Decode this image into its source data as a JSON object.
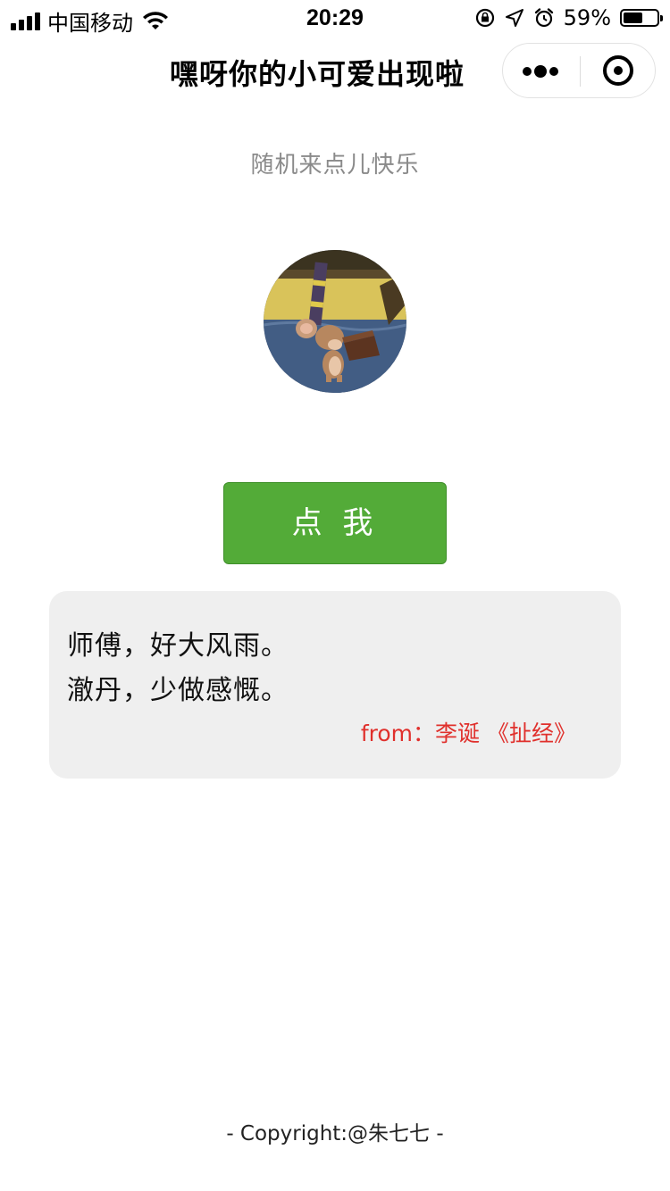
{
  "status_bar": {
    "carrier": "中国移动",
    "time": "20:29",
    "battery_percent": "59%",
    "battery_level": 0.59,
    "icons": [
      "signal-icon",
      "wifi-icon",
      "orientation-lock-icon",
      "location-icon",
      "alarm-icon",
      "battery-icon"
    ]
  },
  "nav": {
    "title": "嘿呀你的小可爱出现啦",
    "capsule_icons": [
      "more-icon",
      "close-miniprogram-icon"
    ]
  },
  "main": {
    "subtitle": "随机来点儿快乐",
    "button_label": "点 我"
  },
  "quote": {
    "line1": "师傅，好大风雨。",
    "line2": "澈丹，少做感慨。",
    "source": "from：李诞 《扯经》"
  },
  "footer": {
    "copyright": "- Copyright:@朱七七 -"
  },
  "colors": {
    "button_green": "#53ab38",
    "source_red": "#e0302c",
    "card_bg": "#efefef",
    "subtitle_gray": "#8a8a8a"
  }
}
